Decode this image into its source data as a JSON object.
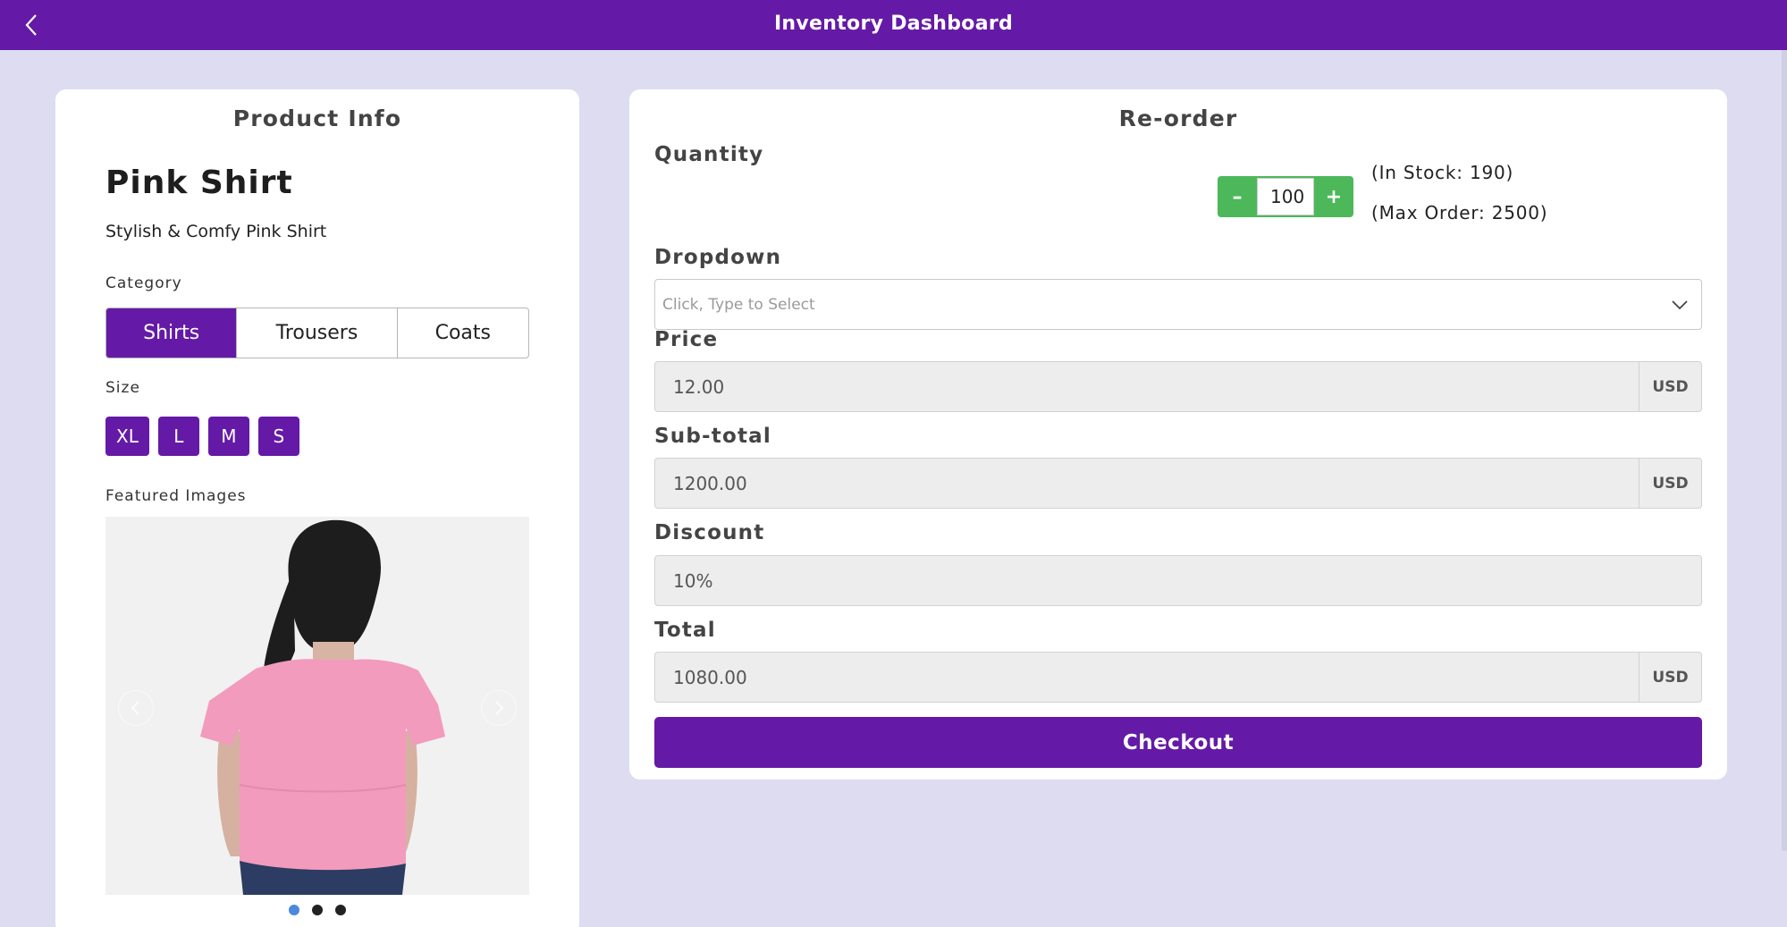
{
  "header": {
    "title": "Inventory Dashboard",
    "back_icon": "chevron-left-icon"
  },
  "product_info": {
    "title": "Product Info",
    "name": "Pink Shirt",
    "description": "Stylish & Comfy Pink Shirt",
    "category_label": "Category",
    "categories": [
      {
        "label": "Shirts",
        "selected": true
      },
      {
        "label": "Trousers",
        "selected": false
      },
      {
        "label": "Coats",
        "selected": false
      }
    ],
    "size_label": "Size",
    "sizes": [
      "XL",
      "L",
      "M",
      "S"
    ],
    "featured_images_label": "Featured Images",
    "carousel": {
      "image_count": 3,
      "active_index": 0
    }
  },
  "reorder": {
    "title": "Re-order",
    "quantity_label": "Quantity",
    "quantity_value": "100",
    "decrement_label": "–",
    "increment_label": "+",
    "in_stock_text": "(In Stock: 190)",
    "max_order_text": "(Max Order: 2500)",
    "dropdown_label": "Dropdown",
    "dropdown_placeholder": "Click, Type to Select",
    "price_label": "Price",
    "price_value": "12.00",
    "price_unit": "USD",
    "subtotal_label": "Sub-total",
    "subtotal_value": "1200.00",
    "subtotal_unit": "USD",
    "discount_label": "Discount",
    "discount_value": "10%",
    "total_label": "Total",
    "total_value": "1080.00",
    "total_unit": "USD",
    "checkout_label": "Checkout"
  },
  "colors": {
    "primary": "#641aa6",
    "background": "#dedcf1",
    "stepper": "#4cb85a"
  }
}
